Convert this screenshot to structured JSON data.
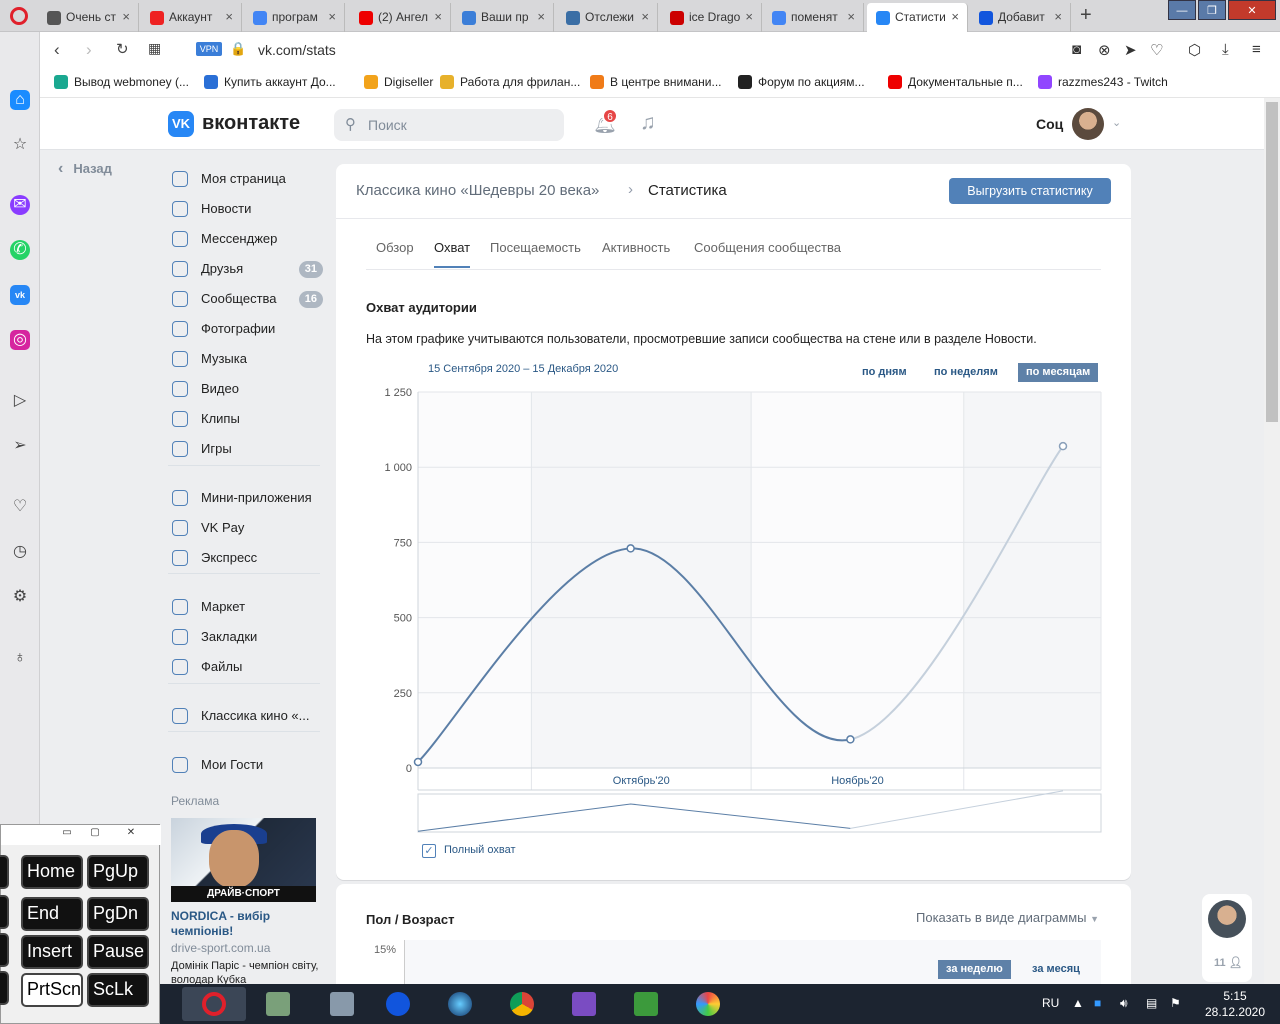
{
  "browser": {
    "tabs": [
      {
        "title": "Очень ст",
        "fav": "film-icon",
        "color": "#555"
      },
      {
        "title": "Аккаунт",
        "fav": "e-icon",
        "color": "#e22"
      },
      {
        "title": "програм",
        "fav": "google-icon",
        "color": "#4285f4"
      },
      {
        "title": "(2) Ангел",
        "fav": "youtube-icon",
        "color": "#e00"
      },
      {
        "title": "Ваши пр",
        "fav": "f-icon",
        "color": "#3b7ed8"
      },
      {
        "title": "Отслежи",
        "fav": "monitor-icon",
        "color": "#3a6ea5"
      },
      {
        "title": "ice Drago",
        "fav": "d-icon",
        "color": "#c00"
      },
      {
        "title": "поменят",
        "fav": "google-icon",
        "color": "#4285f4"
      },
      {
        "title": "Статисти",
        "fav": "vk-icon",
        "color": "#2787f5"
      },
      {
        "title": "Добавит",
        "fav": "dot-icon",
        "color": "#1155dd"
      }
    ],
    "vpn": "VPN",
    "url": "vk.com/stats",
    "bookmarks": [
      {
        "label": "Вывод webmoney (...",
        "color": "#1aa890"
      },
      {
        "label": "Купить аккаунт До...",
        "color": "#2a6fd6"
      },
      {
        "label": "Digiseller",
        "color": "#f2a31b"
      },
      {
        "label": "Работа для фрилан...",
        "color": "#e7b12b"
      },
      {
        "label": "В центре внимани...",
        "color": "#f07b18"
      },
      {
        "label": "Форум по акциям...",
        "color": "#222"
      },
      {
        "label": "Документальные п...",
        "color": "#e00"
      },
      {
        "label": "razzmes243 - Twitch",
        "color": "#9146ff"
      }
    ]
  },
  "vk": {
    "logo": "вконтакте",
    "logo_mark": "VK",
    "search_placeholder": "Поиск",
    "notifications": "6",
    "user_name": "Соц",
    "back": "Назад",
    "menu": [
      {
        "label": "Моя страница",
        "icon": "user-icon"
      },
      {
        "label": "Новости",
        "icon": "news-icon"
      },
      {
        "label": "Мессенджер",
        "icon": "message-icon"
      },
      {
        "label": "Друзья",
        "icon": "friends-icon",
        "count": "31"
      },
      {
        "label": "Сообщества",
        "icon": "groups-icon",
        "count": "16"
      },
      {
        "label": "Фотографии",
        "icon": "photo-icon"
      },
      {
        "label": "Музыка",
        "icon": "music-icon"
      },
      {
        "label": "Видео",
        "icon": "video-icon"
      },
      {
        "label": "Клипы",
        "icon": "clips-icon"
      },
      {
        "label": "Игры",
        "icon": "games-icon"
      },
      {
        "label": "Мини-приложения",
        "icon": "apps-icon"
      },
      {
        "label": "VK Pay",
        "icon": "vkpay-icon"
      },
      {
        "label": "Экспресс",
        "icon": "express-icon"
      },
      {
        "label": "Маркет",
        "icon": "market-icon"
      },
      {
        "label": "Закладки",
        "icon": "bookmark-icon"
      },
      {
        "label": "Файлы",
        "icon": "files-icon"
      },
      {
        "label": "Классика кино «...",
        "icon": "community-icon"
      },
      {
        "label": "Мои Гости",
        "icon": "guests-icon"
      }
    ],
    "ad": {
      "label": "Реклама",
      "banner": "ДРАЙВ·СПОРТ",
      "title": "NORDICA - вибір чемпіонів!",
      "domain": "drive-sport.com.ua",
      "desc": "Домінік Паріс - чемпіон світу, володар Кубка"
    },
    "chat_count": "11"
  },
  "stats": {
    "community": "Классика кино «Шедевры 20 века»",
    "page": "Статистика",
    "export_button": "Выгрузить статистику",
    "tabs": [
      "Обзор",
      "Охват",
      "Посещаемость",
      "Активность",
      "Сообщения сообщества"
    ],
    "active_tab": 1,
    "section_title": "Охват аудитории",
    "section_desc": "На этом графике учитываются пользователи, просмотревшие записи сообщества на стене или в разделе Новости.",
    "date_range": "15 Сентября 2020 – 15 Декабря 2020",
    "periods": [
      "по дням",
      "по неделям",
      "по месяцам"
    ],
    "active_period": 2,
    "legend": "Полный охват",
    "section2_title": "Пол / Возраст",
    "section2_link": "Показать в виде диаграммы",
    "section2_ytick": "15%",
    "section2_periods": [
      "за неделю",
      "за месяц"
    ]
  },
  "chart_data": {
    "type": "line",
    "title": "Охват аудитории",
    "x": [
      "2020-09-15",
      "2020-10-15",
      "2020-11-15",
      "2020-12-15"
    ],
    "xtick_labels": [
      "Октябрь'20",
      "Ноябрь'20"
    ],
    "series": [
      {
        "name": "Полный охват",
        "values": [
          20,
          730,
          95,
          1070
        ]
      }
    ],
    "y_ticks": [
      "0",
      "250",
      "500",
      "750",
      "1 000",
      "1 250"
    ],
    "ylim": [
      0,
      1250
    ],
    "line_color": "#5b7ea6",
    "partial_color": "#c5d0dc",
    "grid": true
  },
  "osk_keys": [
    "Home",
    "PgUp",
    "End",
    "PgDn",
    "Insert",
    "Pause",
    "PrtScn",
    "ScLk"
  ],
  "taskbar": {
    "lang": "RU",
    "time": "5:15",
    "date": "28.12.2020"
  }
}
